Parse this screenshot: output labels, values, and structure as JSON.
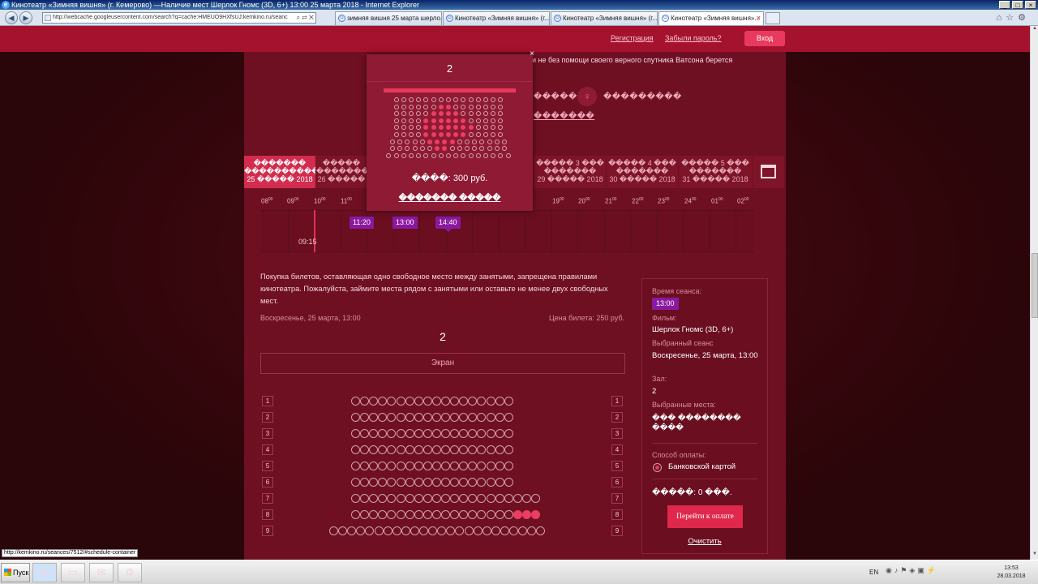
{
  "window": {
    "title": "Кинотеатр «Зимняя вишня» (г. Кемерово) —Наличие мест Шерлок Гномс (3D, 6+) 13:00 25 марта 2018 - Internet Explorer"
  },
  "browser": {
    "address": "http://webcache.googleusercontent.com/search?q=cache:HMEUO9HXfsUJ:kemkino.ru/seanc",
    "tabs": [
      {
        "label": "зимняя вишня 25 марта шерло..."
      },
      {
        "label": "Кинотеатр «Зимняя вишня» (г...."
      },
      {
        "label": "Кинотеатр «Зимняя вишня» (г...."
      },
      {
        "label": "Кинотеатр «Зимняя вишня»..."
      }
    ]
  },
  "header": {
    "register": "Регистрация",
    "forgot": "Забыли пароль?",
    "login": "Вход"
  },
  "movie": {
    "description": "и не без помощи своего верного спутника Ватсона берется",
    "director_label": "������",
    "actors_label": "���������",
    "more_link": "�������"
  },
  "dates": [
    {
      "day": "�������",
      "sub": "�����������",
      "date": "25 ����� 2018"
    },
    {
      "day": "�����",
      "sub": "���������",
      "date": "26 �����"
    },
    {
      "day": "����� 3 ���",
      "sub": "�������",
      "date": "29 ����� 2018"
    },
    {
      "day": "����� 4 ���",
      "sub": "�������",
      "date": "30 ����� 2018"
    },
    {
      "day": "����� 5 ���",
      "sub": "�������",
      "date": "31 ����� 2018"
    }
  ],
  "timeline": {
    "hours": [
      {
        "h": "08",
        "m": "00"
      },
      {
        "h": "09",
        "m": "00"
      },
      {
        "h": "10",
        "m": "00"
      },
      {
        "h": "11",
        "m": "00"
      },
      {
        "h": "19",
        "m": "00"
      },
      {
        "h": "20",
        "m": "00"
      },
      {
        "h": "21",
        "m": "00"
      },
      {
        "h": "22",
        "m": "00"
      },
      {
        "h": "23",
        "m": "00"
      },
      {
        "h": "24",
        "m": "00"
      },
      {
        "h": "01",
        "m": "00"
      },
      {
        "h": "02",
        "m": "00"
      }
    ],
    "now": "09:15",
    "sessions": [
      "11:20",
      "13:00",
      "14:40"
    ]
  },
  "popup": {
    "close": "×",
    "hall": "2",
    "price": "����: 300 руб.",
    "link": "������� �����"
  },
  "booking": {
    "notice": "Покупка билетов, оставляющая одно свободное место между занятыми, запрещена правилами кинотеатра. Пожалуйста, займите места рядом с занятыми или оставьте не менее двух свободных мест.",
    "session_date": "Воскресенье, 25 марта, 13:00",
    "ticket_price": "Цена билета: 250 руб.",
    "hall_title": "2",
    "screen": "Экран",
    "rows": [
      "1",
      "2",
      "3",
      "4",
      "5",
      "6",
      "7",
      "8",
      "9"
    ]
  },
  "sidebar": {
    "time_label": "Время сеанса:",
    "time_value": "13:00",
    "film_label": "Фильм:",
    "film_value": "Шерлок Гномс (3D, 6+)",
    "session_label": "Выбранный сеанс",
    "session_value": "Воскресенье, 25 марта, 13:00",
    "hall_label": "Зал:",
    "hall_value": "2",
    "seats_label": "Выбранные места:",
    "seats_value": "��� �������� ����",
    "payment_label": "Способ оплаты:",
    "payment_value": "Банковской картой",
    "sum": "�����: 0 ���.",
    "pay_button": "Перейти к оплате",
    "clear": "Очистить"
  },
  "status_url": "http://kemkino.ru/seances/7512/#schedule-container",
  "taskbar": {
    "start": "Пуск",
    "lang": "EN",
    "time": "13:53",
    "date": "28.03.2018"
  },
  "colors": {
    "brand": "#a5122d",
    "accent": "#e0284c",
    "session": "#8a19a0"
  }
}
